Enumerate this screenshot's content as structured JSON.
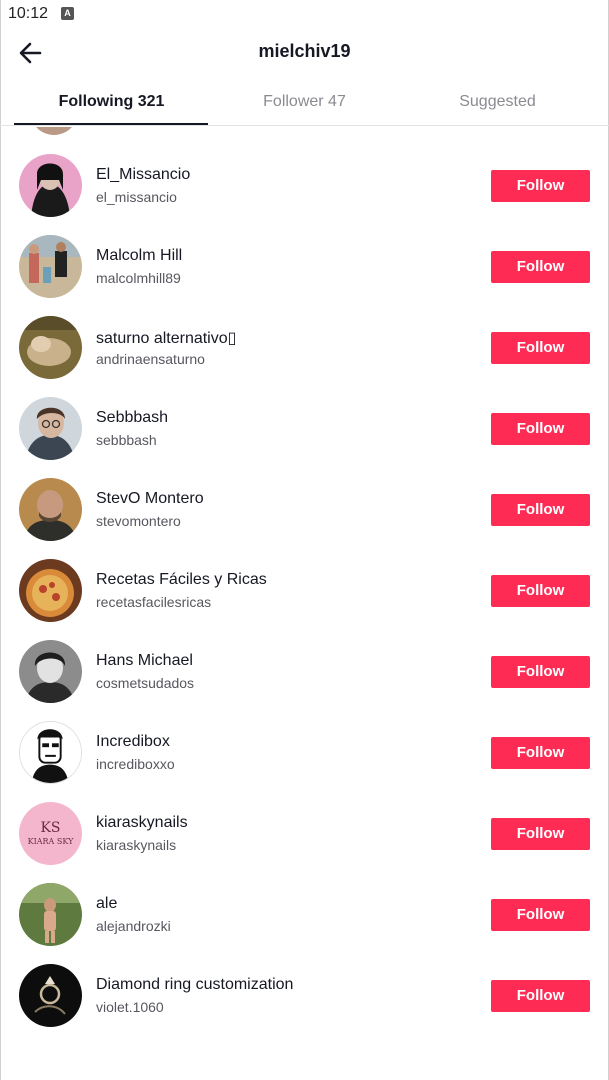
{
  "status_bar": {
    "time": "10:12",
    "notification_icon": "a-square-icon"
  },
  "header": {
    "back_icon": "arrow-left-icon",
    "title": "mielchiv19"
  },
  "tabs": [
    {
      "label": "Following 321",
      "active": true
    },
    {
      "label": "Follower 47",
      "active": false
    },
    {
      "label": "Suggested",
      "active": false
    }
  ],
  "accent_color": "#fe2c55",
  "users": [
    {
      "name": "El_Missancio",
      "handle": "el_missancio",
      "button": "Follow"
    },
    {
      "name": "Malcolm Hill",
      "handle": "malcolmhill89",
      "button": "Follow"
    },
    {
      "name": "saturno alternativo▯",
      "handle": "andrinaensaturno",
      "button": "Follow"
    },
    {
      "name": "Sebbbash",
      "handle": "sebbbash",
      "button": "Follow"
    },
    {
      "name": "StevO Montero",
      "handle": "stevomontero",
      "button": "Follow"
    },
    {
      "name": "Recetas Fáciles y Ricas",
      "handle": "recetasfacilesricas",
      "button": "Follow"
    },
    {
      "name": "Hans Michael",
      "handle": "cosmetsudados",
      "button": "Follow"
    },
    {
      "name": "Incredibox",
      "handle": "incrediboxxo",
      "button": "Follow"
    },
    {
      "name": "kiaraskynails",
      "handle": "kiaraskynails",
      "button": "Follow",
      "avatar_text": "KIARA SKY"
    },
    {
      "name": "ale",
      "handle": "alejandrozki",
      "button": "Follow"
    },
    {
      "name": "Diamond ring customization",
      "handle": "violet.1060",
      "button": "Follow"
    }
  ]
}
